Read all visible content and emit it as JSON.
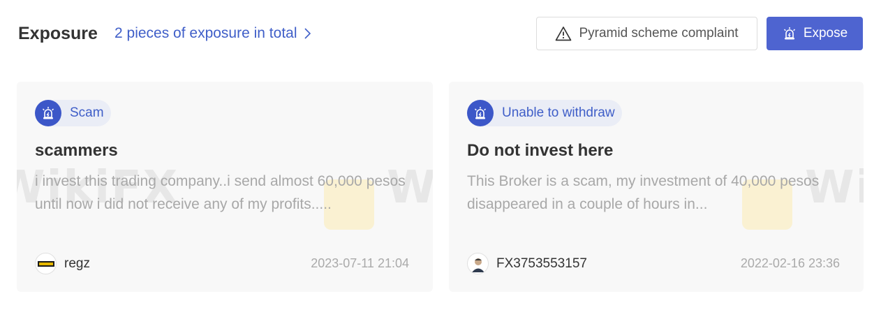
{
  "header": {
    "title": "Exposure",
    "total_link": "2 pieces of exposure in total",
    "complaint_button": "Pyramid scheme complaint",
    "expose_button": "Expose"
  },
  "colors": {
    "accent": "#4e64d0",
    "link": "#3f5ec8",
    "tag_bg": "#eaedf6",
    "card_bg": "#f8f8f8"
  },
  "cards": [
    {
      "tag": "Scam",
      "tag_icon": "alarm-icon",
      "title": "scammers",
      "body": "i invest this trading company..i send almost 60,000 pesos until now i did not receive any of my profits.....",
      "author": "regz",
      "date": "2023-07-11 21:04"
    },
    {
      "tag": "Unable to withdraw",
      "tag_icon": "alarm-icon",
      "title": "Do not invest here",
      "body": "This Broker is a scam, my investment of 40,000 pesos disappeared in a couple of hours in...",
      "author": "FX3753553157",
      "date": "2022-02-16 23:36"
    }
  ],
  "watermark": "WikiFX"
}
